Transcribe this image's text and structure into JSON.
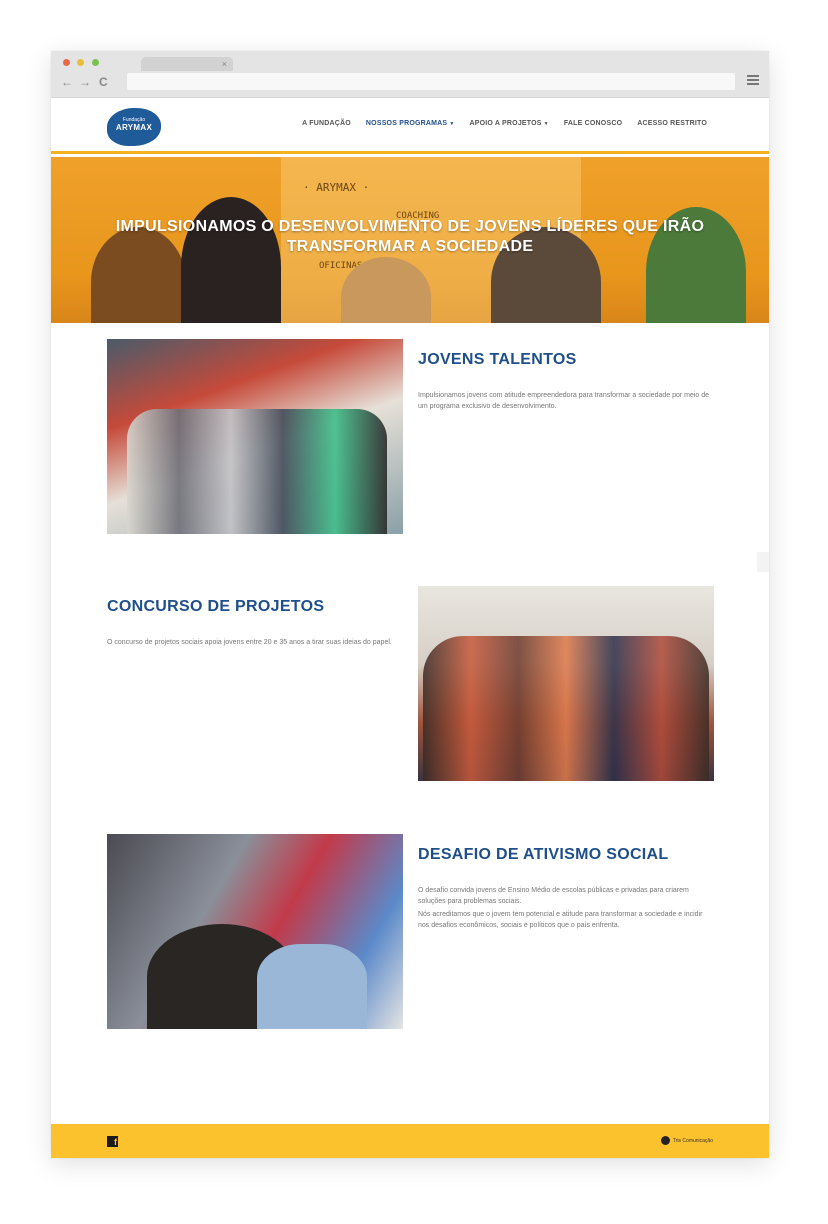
{
  "browser": {
    "tab_close": "×",
    "back": "←",
    "forward": "→",
    "reload": "C"
  },
  "logo": {
    "small": "Fundação",
    "big": "ARYMAX"
  },
  "nav": {
    "items": [
      {
        "label": "A FUNDAÇÃO"
      },
      {
        "label": "NOSSOS PROGRAMAS",
        "caret": "▼"
      },
      {
        "label": "APOIO A PROJETOS",
        "caret": "▼"
      },
      {
        "label": "FALE CONOSCO"
      },
      {
        "label": "ACESSO RESTRITO"
      }
    ]
  },
  "hero": {
    "title": "IMPULSIONAMOS O DESENVOLVIMENTO DE JOVENS LÍDERES QUE IRÃO TRANSFORMAR A SOCIEDADE",
    "board": [
      "· ARYMAX ·",
      "COACHING",
      "OFICINAS"
    ]
  },
  "sections": [
    {
      "title": "JOVENS TALENTOS",
      "text": [
        "Impulsionamos jovens com atitude empreendedora para transformar a sociedade por meio de um programa exclusivo de desenvolvimento."
      ]
    },
    {
      "title": "CONCURSO DE PROJETOS",
      "text": [
        "O concurso de projetos sociais apoia jovens entre 20 e 35 anos a tirar suas ideias do papel."
      ]
    },
    {
      "title": "DESAFIO DE ATIVISMO SOCIAL",
      "text": [
        "O desafio convida jovens de Ensino Médio de escolas públicas e privadas para criarem soluções para problemas sociais.",
        "Nós acreditamos que o jovem tem potencial e atitude para transformar a sociedade e incidir nos desafios econômicos, sociais e políticos que o país enfrenta."
      ]
    }
  ],
  "footer": {
    "facebook": "f",
    "credit": "Tris Comunicação"
  },
  "colors": {
    "brand_blue": "#1f4f8a",
    "accent_yellow": "#fcc22e",
    "hero_orange": "#f0a12a"
  }
}
